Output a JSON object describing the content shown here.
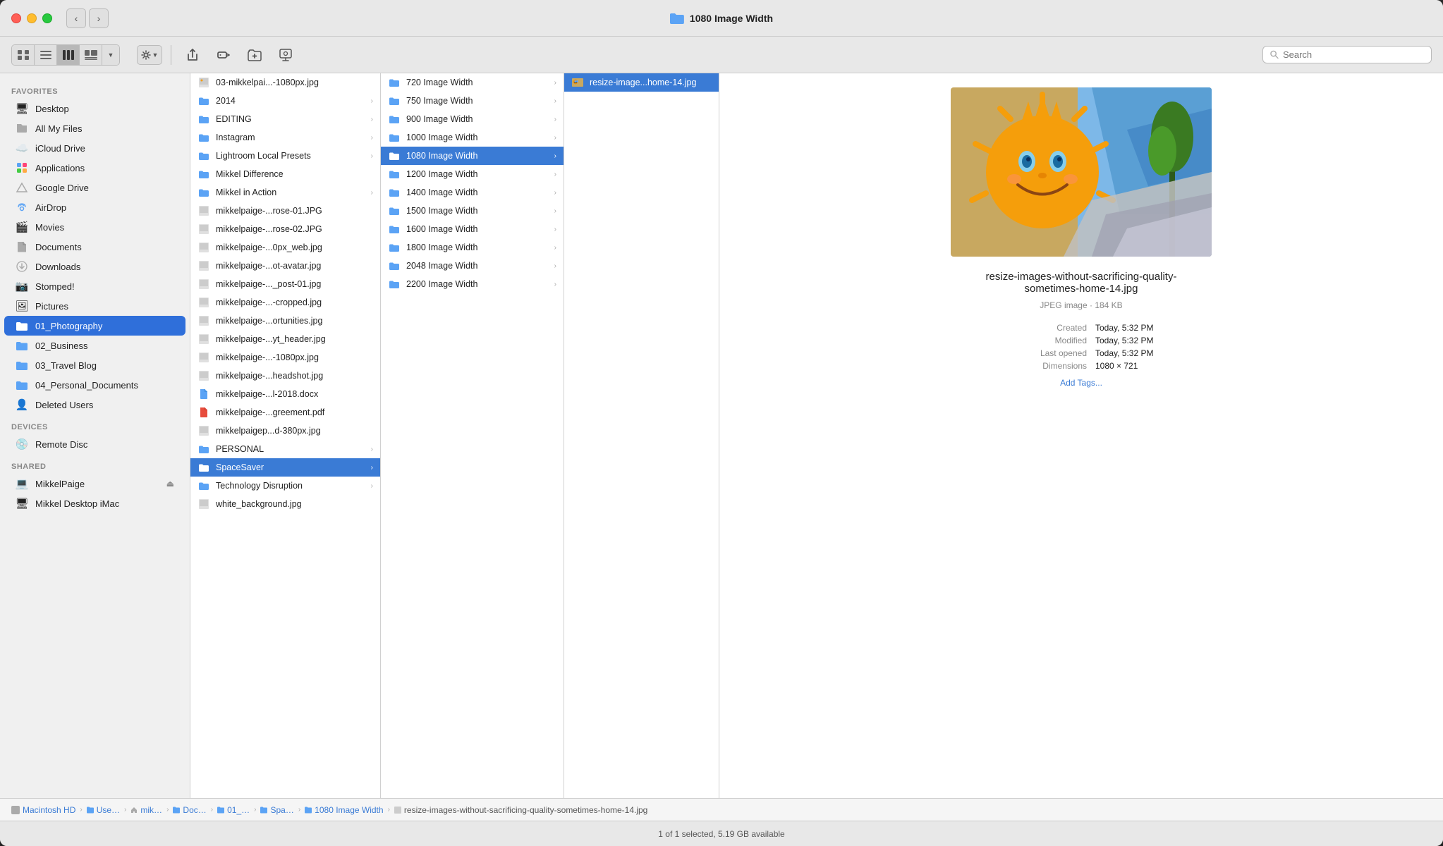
{
  "window": {
    "title": "1080 Image Width",
    "searchPlaceholder": "Search"
  },
  "toolbar": {
    "backLabel": "‹",
    "forwardLabel": "›"
  },
  "sidebar": {
    "sections": [
      {
        "label": "Favorites",
        "items": [
          {
            "id": "desktop",
            "label": "Desktop",
            "icon": "🖥",
            "active": false
          },
          {
            "id": "all-my-files",
            "label": "All My Files",
            "icon": "📁",
            "active": false
          },
          {
            "id": "icloud-drive",
            "label": "iCloud Drive",
            "icon": "☁️",
            "active": false
          },
          {
            "id": "applications",
            "label": "Applications",
            "icon": "📦",
            "active": false
          },
          {
            "id": "google-drive",
            "label": "Google Drive",
            "icon": "△",
            "active": false
          },
          {
            "id": "airdrop",
            "label": "AirDrop",
            "icon": "📡",
            "active": false
          },
          {
            "id": "movies",
            "label": "Movies",
            "icon": "🎬",
            "active": false
          },
          {
            "id": "documents",
            "label": "Documents",
            "icon": "📄",
            "active": false
          },
          {
            "id": "downloads",
            "label": "Downloads",
            "icon": "⬇️",
            "active": false
          },
          {
            "id": "stomped",
            "label": "Stomped!",
            "icon": "📷",
            "active": false
          },
          {
            "id": "pictures",
            "label": "Pictures",
            "icon": "🖼",
            "active": false
          },
          {
            "id": "01-photography",
            "label": "01_Photography",
            "icon": "📁",
            "active": true
          },
          {
            "id": "02-business",
            "label": "02_Business",
            "icon": "📁",
            "active": false
          },
          {
            "id": "03-travel-blog",
            "label": "03_Travel Blog",
            "icon": "📁",
            "active": false
          },
          {
            "id": "04-personal-documents",
            "label": "04_Personal_Documents",
            "icon": "📁",
            "active": false
          },
          {
            "id": "deleted-users",
            "label": "Deleted Users",
            "icon": "👤",
            "active": false
          }
        ]
      },
      {
        "label": "Devices",
        "items": [
          {
            "id": "remote-disc",
            "label": "Remote Disc",
            "icon": "💿",
            "active": false
          }
        ]
      },
      {
        "label": "Shared",
        "items": [
          {
            "id": "mikkelpaige",
            "label": "MikkelPaige",
            "icon": "💻",
            "active": false,
            "eject": true
          },
          {
            "id": "mikkel-desktop-imac",
            "label": "Mikkel Desktop iMac",
            "icon": "🖥",
            "active": false
          }
        ]
      }
    ]
  },
  "panel1": {
    "items": [
      {
        "id": "p1-0",
        "name": "03-mikkelpai...-1080px.jpg",
        "icon": "img",
        "hasArrow": false
      },
      {
        "id": "p1-1",
        "name": "2014",
        "icon": "folder",
        "hasArrow": true
      },
      {
        "id": "p1-2",
        "name": "EDITING",
        "icon": "folder",
        "hasArrow": true
      },
      {
        "id": "p1-3",
        "name": "Instagram",
        "icon": "folder",
        "hasArrow": true
      },
      {
        "id": "p1-4",
        "name": "Lightroom Local Presets",
        "icon": "folder",
        "hasArrow": true
      },
      {
        "id": "p1-5",
        "name": "Mikkel Difference",
        "icon": "folder",
        "hasArrow": false
      },
      {
        "id": "p1-6",
        "name": "Mikkel in Action",
        "icon": "folder",
        "hasArrow": true
      },
      {
        "id": "p1-7",
        "name": "mikkelpaige-...rose-01.JPG",
        "icon": "img",
        "hasArrow": false
      },
      {
        "id": "p1-8",
        "name": "mikkelpaige-...rose-02.JPG",
        "icon": "img",
        "hasArrow": false
      },
      {
        "id": "p1-9",
        "name": "mikkelpaige-...0px_web.jpg",
        "icon": "img",
        "hasArrow": false
      },
      {
        "id": "p1-10",
        "name": "mikkelpaige-...ot-avatar.jpg",
        "icon": "img",
        "hasArrow": false
      },
      {
        "id": "p1-11",
        "name": "mikkelpaige-..._post-01.jpg",
        "icon": "img",
        "hasArrow": false
      },
      {
        "id": "p1-12",
        "name": "mikkelpaige-...-cropped.jpg",
        "icon": "img",
        "hasArrow": false
      },
      {
        "id": "p1-13",
        "name": "mikkelpaige-...ortunities.jpg",
        "icon": "img",
        "hasArrow": false
      },
      {
        "id": "p1-14",
        "name": "mikkelpaige-...yt_header.jpg",
        "icon": "img",
        "hasArrow": false
      },
      {
        "id": "p1-15",
        "name": "mikkelpaige-...-1080px.jpg",
        "icon": "img",
        "hasArrow": false
      },
      {
        "id": "p1-16",
        "name": "mikkelpaige-...headshot.jpg",
        "icon": "img",
        "hasArrow": false
      },
      {
        "id": "p1-17",
        "name": "mikkelpaige-...l-2018.docx",
        "icon": "doc",
        "hasArrow": false
      },
      {
        "id": "p1-18",
        "name": "mikkelpaige-...greement.pdf",
        "icon": "pdf",
        "hasArrow": false
      },
      {
        "id": "p1-19",
        "name": "mikkelpaigep...d-380px.jpg",
        "icon": "img",
        "hasArrow": false
      },
      {
        "id": "p1-20",
        "name": "PERSONAL",
        "icon": "folder",
        "hasArrow": true
      },
      {
        "id": "p1-21",
        "name": "SpaceSaver",
        "icon": "folder",
        "hasArrow": true,
        "selected": true
      },
      {
        "id": "p1-22",
        "name": "Technology Disruption",
        "icon": "folder",
        "hasArrow": true
      },
      {
        "id": "p1-23",
        "name": "white_background.jpg",
        "icon": "img",
        "hasArrow": false
      }
    ]
  },
  "panel2": {
    "items": [
      {
        "id": "p2-0",
        "name": "720 Image Width",
        "icon": "folder",
        "hasArrow": true
      },
      {
        "id": "p2-1",
        "name": "750 Image Width",
        "icon": "folder",
        "hasArrow": true
      },
      {
        "id": "p2-2",
        "name": "900 Image Width",
        "icon": "folder",
        "hasArrow": true
      },
      {
        "id": "p2-3",
        "name": "1000 Image Width",
        "icon": "folder",
        "hasArrow": true
      },
      {
        "id": "p2-4",
        "name": "1080 Image Width",
        "icon": "folder",
        "hasArrow": true,
        "selected": true
      },
      {
        "id": "p2-5",
        "name": "1200 Image Width",
        "icon": "folder",
        "hasArrow": true
      },
      {
        "id": "p2-6",
        "name": "1400 Image Width",
        "icon": "folder",
        "hasArrow": true
      },
      {
        "id": "p2-7",
        "name": "1500 Image Width",
        "icon": "folder",
        "hasArrow": true
      },
      {
        "id": "p2-8",
        "name": "1600 Image Width",
        "icon": "folder",
        "hasArrow": true
      },
      {
        "id": "p2-9",
        "name": "1800 Image Width",
        "icon": "folder",
        "hasArrow": true
      },
      {
        "id": "p2-10",
        "name": "2048 Image Width",
        "icon": "folder",
        "hasArrow": true
      },
      {
        "id": "p2-11",
        "name": "2200 Image Width",
        "icon": "folder",
        "hasArrow": true
      }
    ]
  },
  "panel3": {
    "items": [
      {
        "id": "p3-0",
        "name": "resize-image...home-14.jpg",
        "icon": "img",
        "hasArrow": false,
        "selected": true
      }
    ]
  },
  "preview": {
    "filename": "resize-images-without-sacrificing-quality-sometimes-home-14.jpg",
    "filetype": "JPEG image · 184 KB",
    "created": "Today, 5:32 PM",
    "modified": "Today, 5:32 PM",
    "lastOpened": "Today, 5:32 PM",
    "dimensions": "1080 × 721",
    "addTagsLabel": "Add Tags..."
  },
  "breadcrumb": {
    "items": [
      {
        "label": "Macintosh HD",
        "icon": "hd"
      },
      {
        "label": "Use…",
        "icon": "folder"
      },
      {
        "label": "mik…",
        "icon": "home"
      },
      {
        "label": "Doc…",
        "icon": "folder"
      },
      {
        "label": "01_…",
        "icon": "folder"
      },
      {
        "label": "Spa…",
        "icon": "folder"
      },
      {
        "label": "1080 Image Width",
        "icon": "folder"
      },
      {
        "label": "resize-images-without-sacrificing-quality-sometimes-home-14.jpg",
        "icon": "img",
        "last": true
      }
    ]
  },
  "statusbar": {
    "text": "1 of 1 selected, 5.19 GB available"
  }
}
